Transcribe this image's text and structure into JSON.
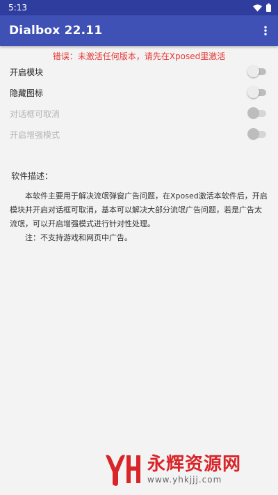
{
  "status_bar": {
    "time": "5:13"
  },
  "app_bar": {
    "title": "Dialbox 22.11"
  },
  "error_message": "错误：未激活任何版本，请先在Xposed里激活",
  "settings": [
    {
      "label": "开启模块",
      "enabled": true,
      "checked": false
    },
    {
      "label": "隐藏图标",
      "enabled": true,
      "checked": false
    },
    {
      "label": "对话框可取消",
      "enabled": false,
      "checked": false
    },
    {
      "label": "开启增强模式",
      "enabled": false,
      "checked": false
    }
  ],
  "description": {
    "title": "软件描述：",
    "paragraph1": "本软件主要用于解决流氓弹窗广告问题，在Xposed激活本软件后，开启模块并开启对话框可取消，基本可以解决大部分流氓广告问题，若是广告太流氓，可以开启增强模式进行针对性处理。",
    "paragraph2": "注：不支持游戏和网页中广告。"
  },
  "watermark": {
    "logo_text": "YH",
    "name": "永辉资源网",
    "url": "www.yhkjjj.com"
  },
  "colors": {
    "status_bar": "#2f3d9e",
    "app_bar": "#3f51b5",
    "error": "#e53935",
    "watermark": "#d9252a"
  }
}
